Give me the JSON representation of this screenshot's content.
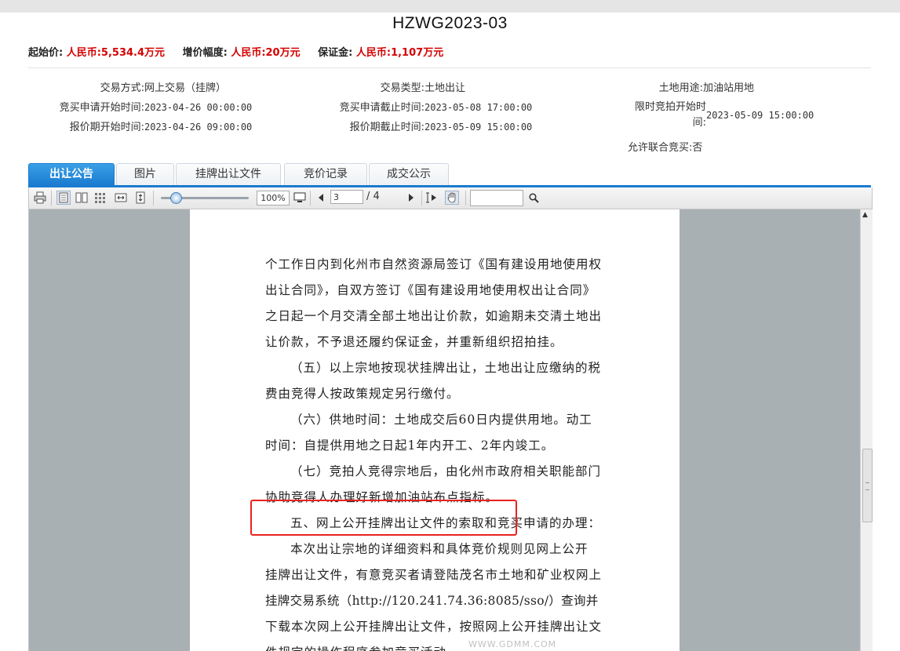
{
  "title": "HZWG2023-03",
  "prices": [
    {
      "label": "起始价:",
      "value": "人民币:5,534.4万元"
    },
    {
      "label": "增价幅度:",
      "value": "人民币:20万元"
    },
    {
      "label": "保证金:",
      "value": "人民币:1,107万元"
    }
  ],
  "info": {
    "trade_method_label": "交易方式:",
    "trade_method_value": "网上交易（挂牌）",
    "apply_start_label": "竞买申请开始时间:",
    "apply_start_value": "2023-04-26 00:00:00",
    "quote_start_label": "报价期开始时间:",
    "quote_start_value": "2023-04-26 09:00:00",
    "trade_type_label": "交易类型:",
    "trade_type_value": "土地出让",
    "apply_end_label": "竞买申请截止时间:",
    "apply_end_value": "2023-05-08 17:00:00",
    "quote_end_label": "报价期截止时间:",
    "quote_end_value": "2023-05-09 15:00:00",
    "land_use_label": "土地用途:",
    "land_use_value": "加油站用地",
    "auction_start_label_1": "限时竞拍开始时",
    "auction_start_label_2": "间:",
    "auction_start_value": "2023-05-09 15:00:00",
    "joint_label": "允许联合竞买:",
    "joint_value": "否"
  },
  "tabs": [
    "出让公告",
    "图片",
    "挂牌出让文件",
    "竞价记录",
    "成交公示"
  ],
  "toolbar": {
    "zoom": "100%",
    "page_current": "3",
    "page_total": "/ 4",
    "icons": [
      "print-icon",
      "single-page-icon",
      "two-page-icon",
      "thumbnail-grid-icon",
      "fit-width-icon",
      "fit-height-icon",
      "fullscreen-icon",
      "prev-page-icon",
      "next-page-icon",
      "text-select-icon",
      "hand-tool-icon",
      "search-icon"
    ]
  },
  "document": {
    "lines": [
      "个工作日内到化州市自然资源局签订《国有建设用地使用权",
      "出让合同》，自双方签订《国有建设用地使用权出让合同》",
      "之日起一个月交清全部土地出让价款，如逾期未交清土地出",
      "让价款，不予退还履约保证金，并重新组织招拍挂。",
      "（五）以上宗地按现状挂牌出让，土地出让应缴纳的税",
      "费由竞得人按政策规定另行缴付。",
      "（六）供地时间：土地成交后60日内提供用地。动工",
      "时间：自提供用地之日起1年内开工、2年内竣工。",
      "（七）竞拍人竞得宗地后，由化州市政府相关职能部门",
      "协助竞得人办理好新增加油站布点指标。",
      "五、网上公开挂牌出让文件的索取和竞买申请的办理：",
      "本次出让宗地的详细资料和具体竞价规则见网上公开",
      "挂牌出让文件，有意竞买者请登陆茂名市土地和矿业权网上",
      "挂牌交易系统（http://120.241.74.36:8085/sso/）查询并",
      "下载本次网上公开挂牌出让文件，按照网上公开挂牌出让文",
      "件规定的操作程序参加竞买活动。"
    ],
    "watermark": "WWW.GDMM.COM"
  }
}
